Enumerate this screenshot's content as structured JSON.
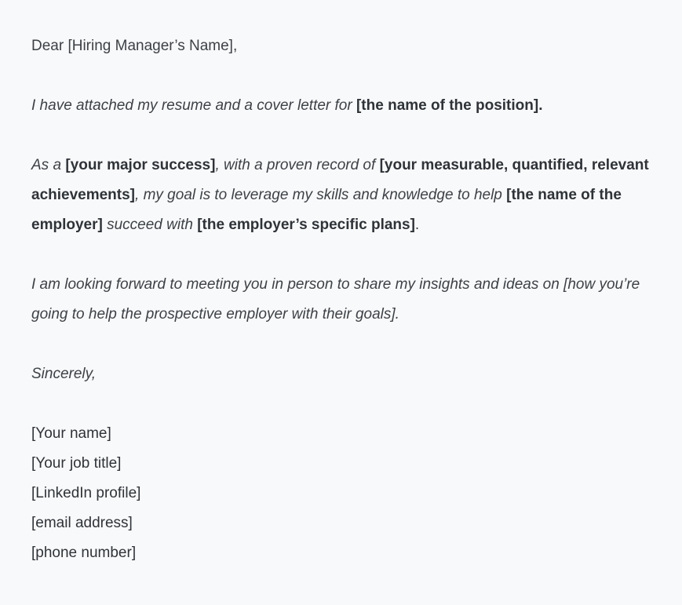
{
  "salutation": "Dear [Hiring Manager’s Name],",
  "para1": {
    "text": "I have attached my resume and a cover letter for ",
    "position": "[the name of the position]."
  },
  "para2": {
    "t1": "As a ",
    "b1": "[your major success]",
    "t2": ", with a proven record of ",
    "b2": "[your measurable, quantified, relevant achievements]",
    "t3": ", my goal is to leverage my skills and knowledge to help ",
    "b3": "[the name of the employer]",
    "t4": " succeed with ",
    "b4": "[the employer’s specific plans]",
    "t5": "."
  },
  "para3": "I am looking forward to meeting you in person to share my insights and ideas on [how you’re going to help the prospective employer with their goals].",
  "closing": "Sincerely,",
  "signature": {
    "name": "[Your name]",
    "job_title": "[Your job title]",
    "linkedin": "[LinkedIn profile]",
    "email": "[email address]",
    "phone": "[phone number]"
  }
}
